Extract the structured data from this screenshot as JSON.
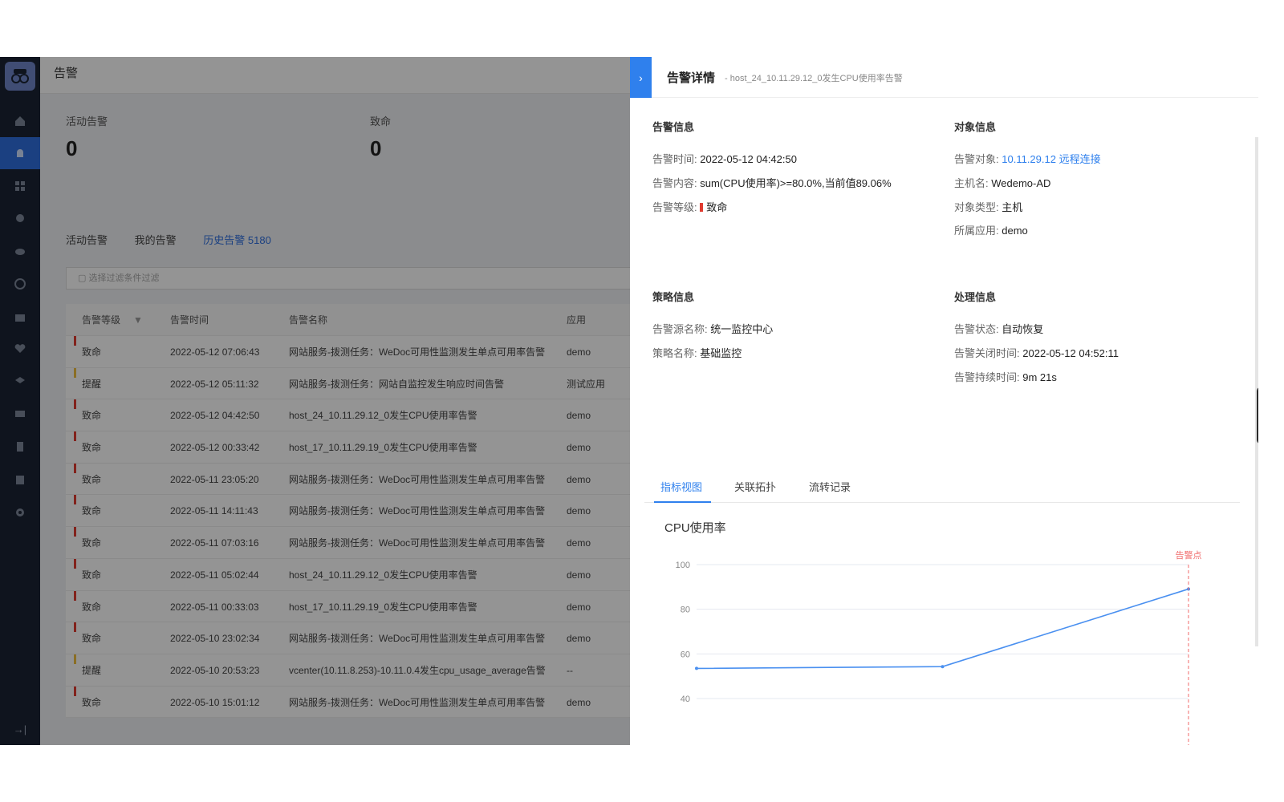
{
  "app": {
    "page_title": "告警",
    "stats": [
      {
        "label": "活动告警",
        "value": "0"
      },
      {
        "label": "致命",
        "value": "0"
      }
    ],
    "tabs": [
      {
        "label": "活动告警"
      },
      {
        "label": "我的告警"
      },
      {
        "label": "历史告警 5180",
        "active": true
      }
    ],
    "filter_placeholder": "选择过滤条件过滤",
    "table": {
      "headers": [
        "告警等级",
        "告警时间",
        "告警名称",
        "应用"
      ],
      "rows": [
        {
          "level": "致命",
          "time": "2022-05-12 07:06:43",
          "name": "网站服务-拨测任务：WeDoc可用性监测发生单点可用率告警",
          "app": "demo"
        },
        {
          "level": "提醒",
          "time": "2022-05-12 05:11:32",
          "name": "网站服务-拨测任务：网站自监控发生响应时间告警",
          "app": "测试应用"
        },
        {
          "level": "致命",
          "time": "2022-05-12 04:42:50",
          "name": "host_24_10.11.29.12_0发生CPU使用率告警",
          "app": "demo"
        },
        {
          "level": "致命",
          "time": "2022-05-12 00:33:42",
          "name": "host_17_10.11.29.19_0发生CPU使用率告警",
          "app": "demo"
        },
        {
          "level": "致命",
          "time": "2022-05-11 23:05:20",
          "name": "网站服务-拨测任务：WeDoc可用性监测发生单点可用率告警",
          "app": "demo"
        },
        {
          "level": "致命",
          "time": "2022-05-11 14:11:43",
          "name": "网站服务-拨测任务：WeDoc可用性监测发生单点可用率告警",
          "app": "demo"
        },
        {
          "level": "致命",
          "time": "2022-05-11 07:03:16",
          "name": "网站服务-拨测任务：WeDoc可用性监测发生单点可用率告警",
          "app": "demo"
        },
        {
          "level": "致命",
          "time": "2022-05-11 05:02:44",
          "name": "host_24_10.11.29.12_0发生CPU使用率告警",
          "app": "demo"
        },
        {
          "level": "致命",
          "time": "2022-05-11 00:33:03",
          "name": "host_17_10.11.29.19_0发生CPU使用率告警",
          "app": "demo"
        },
        {
          "level": "致命",
          "time": "2022-05-10 23:02:34",
          "name": "网站服务-拨测任务：WeDoc可用性监测发生单点可用率告警",
          "app": "demo"
        },
        {
          "level": "提醒",
          "time": "2022-05-10 20:53:23",
          "name": "vcenter(10.11.8.253)-10.11.0.4发生cpu_usage_average告警",
          "app": "--"
        },
        {
          "level": "致命",
          "time": "2022-05-10 15:01:12",
          "name": "网站服务-拨测任务：WeDoc可用性监测发生单点可用率告警",
          "app": "demo"
        }
      ]
    }
  },
  "drawer": {
    "toggle_icon": "chevron-right",
    "title": "告警详情",
    "subtitle": "- host_24_10.11.29.12_0发生CPU使用率告警",
    "alert_info": {
      "title": "告警信息",
      "time_label": "告警时间:",
      "time": "2022-05-12 04:42:50",
      "content_label": "告警内容:",
      "content": "sum(CPU使用率)>=80.0%,当前值89.06%",
      "level_label": "告警等级:",
      "level": "致命"
    },
    "object_info": {
      "title": "对象信息",
      "target_label": "告警对象:",
      "target": "10.11.29.12",
      "remote": "远程连接",
      "host_label": "主机名:",
      "host": "Wedemo-AD",
      "type_label": "对象类型:",
      "type": "主机",
      "app_label": "所属应用:",
      "app": "demo"
    },
    "policy_info": {
      "title": "策略信息",
      "source_label": "告警源名称:",
      "source": "统一监控中心",
      "policy_label": "策略名称:",
      "policy": "基础监控"
    },
    "handle_info": {
      "title": "处理信息",
      "status_label": "告警状态:",
      "status": "自动恢复",
      "close_label": "告警关闭时间:",
      "close_time": "2022-05-12 04:52:11",
      "duration_label": "告警持续时间:",
      "duration": "9m 21s"
    },
    "tabs": [
      {
        "label": "指标视图",
        "active": true
      },
      {
        "label": "关联拓扑"
      },
      {
        "label": "流转记录"
      }
    ]
  },
  "colors": {
    "accent": "#2f80ed",
    "fatal": "#e03c31",
    "remind": "#f0c040",
    "line": "#4a90f0",
    "alarm": "#f06a6a"
  },
  "chart_data": {
    "type": "line",
    "title": "CPU使用率",
    "y_ticks": [
      100,
      80,
      60,
      40
    ],
    "ylim": [
      40,
      100
    ],
    "x": [
      0,
      1,
      2
    ],
    "series": [
      {
        "values": [
          53.5,
          54.3,
          89.06
        ]
      }
    ],
    "marker": {
      "label": "告警点",
      "x": 2
    },
    "grid": true
  }
}
